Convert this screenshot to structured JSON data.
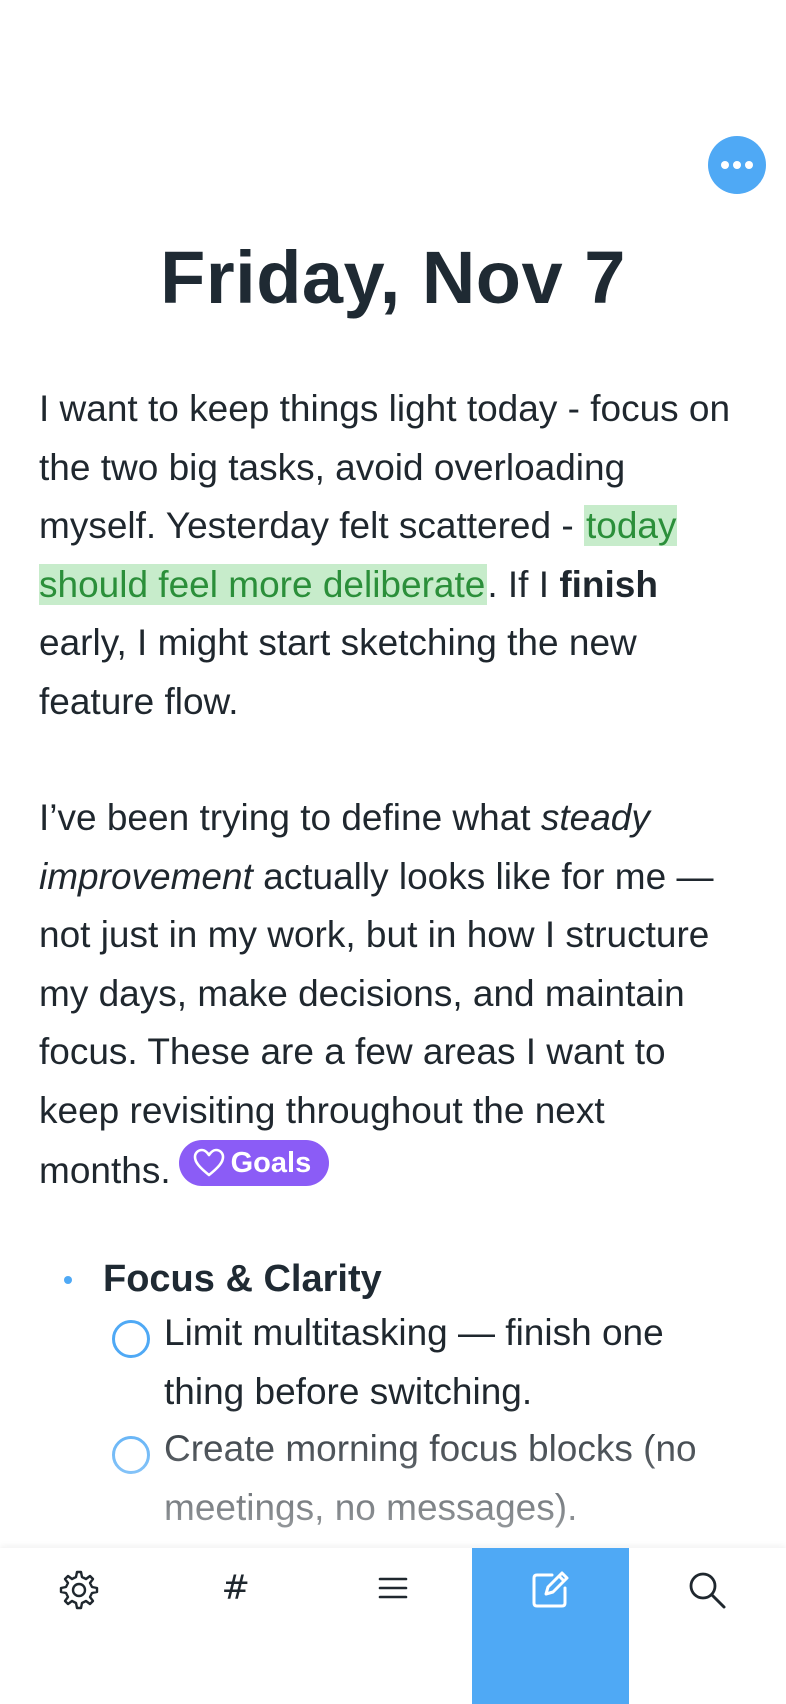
{
  "header": {
    "title": "Friday, Nov 7",
    "more_icon": "ellipsis-icon"
  },
  "entry": {
    "para1": {
      "text_a": "I want to keep things light today - focus on the two big tasks, avoid overloading myself. Yesterday felt scattered - ",
      "highlight": "today should feel more deliberate",
      "text_b": ". If I ",
      "bold": "finish",
      "text_c": " early, I might start sketching the new feature flow."
    },
    "para2": {
      "text_a": "I’ve been trying to define what ",
      "italic": "steady improvement",
      "text_b": " actually looks like for me — not just in my work, but in how I structure my days, make decisions, and maintain focus. These are a few areas I want to keep revisiting throughout the next months."
    },
    "tag": {
      "label": "Goals",
      "icon": "heart-icon"
    },
    "list": {
      "bullet": "Focus & Clarity",
      "todos": [
        "Limit multitasking — finish one thing before switching.",
        "Create morning focus blocks (no meetings, no messages)."
      ]
    }
  },
  "tabbar": {
    "tabs": [
      {
        "name": "settings",
        "icon": "gear-icon"
      },
      {
        "name": "tags",
        "icon": "hash-icon",
        "glyph": "#"
      },
      {
        "name": "list",
        "icon": "list-icon"
      },
      {
        "name": "compose",
        "icon": "compose-icon",
        "active": true
      },
      {
        "name": "search",
        "icon": "search-icon"
      }
    ]
  },
  "colors": {
    "accent": "#4fa9f5",
    "highlight_bg": "#c7eccb",
    "highlight_text": "#2b8f3a",
    "tag_bg": "#8b5cf6",
    "text": "#1f272e"
  }
}
